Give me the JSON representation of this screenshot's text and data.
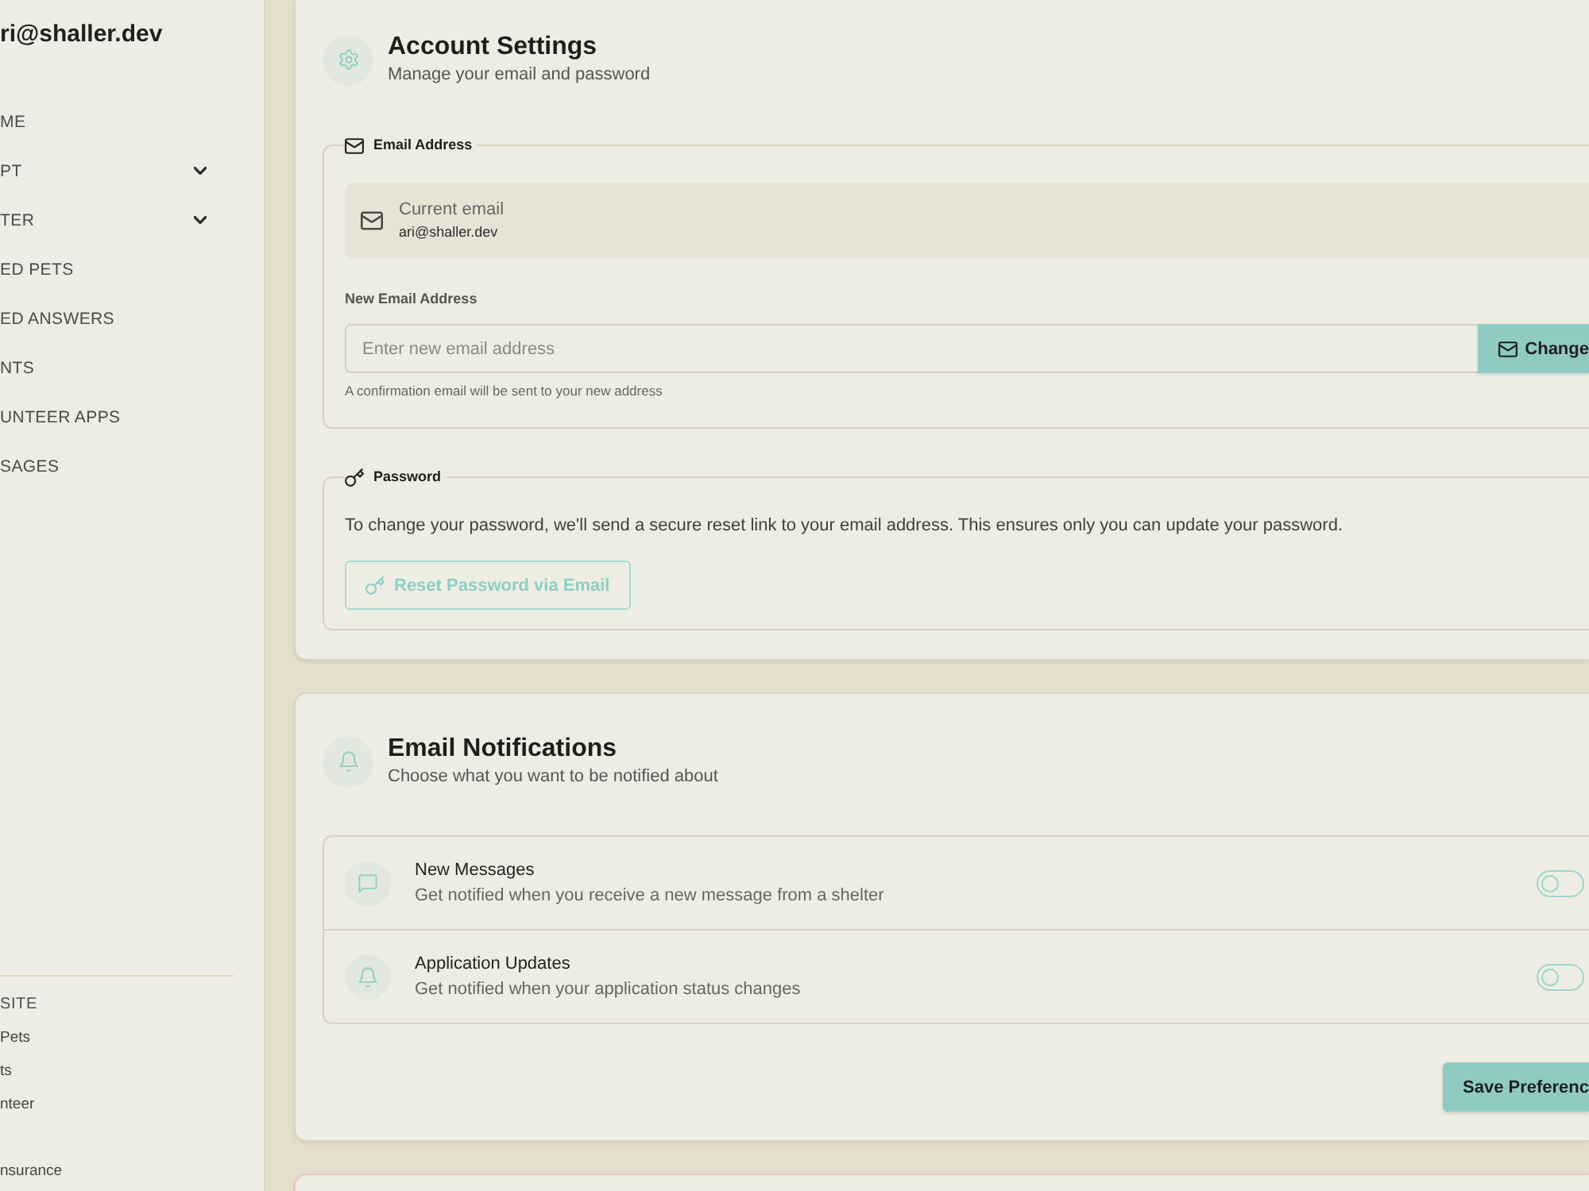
{
  "sidebar": {
    "user_email": "ri@shaller.dev",
    "nav_items": [
      {
        "label": "ME",
        "kind": "link"
      },
      {
        "label": "PT",
        "kind": "group",
        "expanded": false
      },
      {
        "label": "TER",
        "kind": "group",
        "expanded": false
      },
      {
        "label": "ED PETS",
        "kind": "link"
      },
      {
        "label": "ED ANSWERS",
        "kind": "link"
      },
      {
        "label": "NTS",
        "kind": "link"
      },
      {
        "label": "UNTEER APPS",
        "kind": "link"
      },
      {
        "label": "SAGES",
        "kind": "link"
      }
    ],
    "footer": {
      "heading": "SITE",
      "links": [
        "Pets",
        "ts",
        "nteer",
        "nsurance"
      ]
    }
  },
  "account_settings": {
    "title": "Account Settings",
    "subtitle": "Manage your email and password",
    "email_section": {
      "legend": "Email Address",
      "current_label": "Current email",
      "current_value": "ari@shaller.dev",
      "new_label": "New Email Address",
      "placeholder": "Enter new email address",
      "button": "Change",
      "hint": "A confirmation email will be sent to your new address"
    },
    "password_section": {
      "legend": "Password",
      "description": "To change your password, we'll send a secure reset link to your email address. This ensures only you can update your password.",
      "button": "Reset Password via Email"
    }
  },
  "email_notifications": {
    "title": "Email Notifications",
    "subtitle": "Choose what you want to be notified about",
    "options": [
      {
        "kind": "message",
        "title": "New Messages",
        "description": "Get notified when you receive a new message from a shelter",
        "on": false
      },
      {
        "kind": "bell",
        "title": "Application Updates",
        "description": "Get notified when your application status changes",
        "on": false
      }
    ],
    "button": "Save Preferenc"
  }
}
